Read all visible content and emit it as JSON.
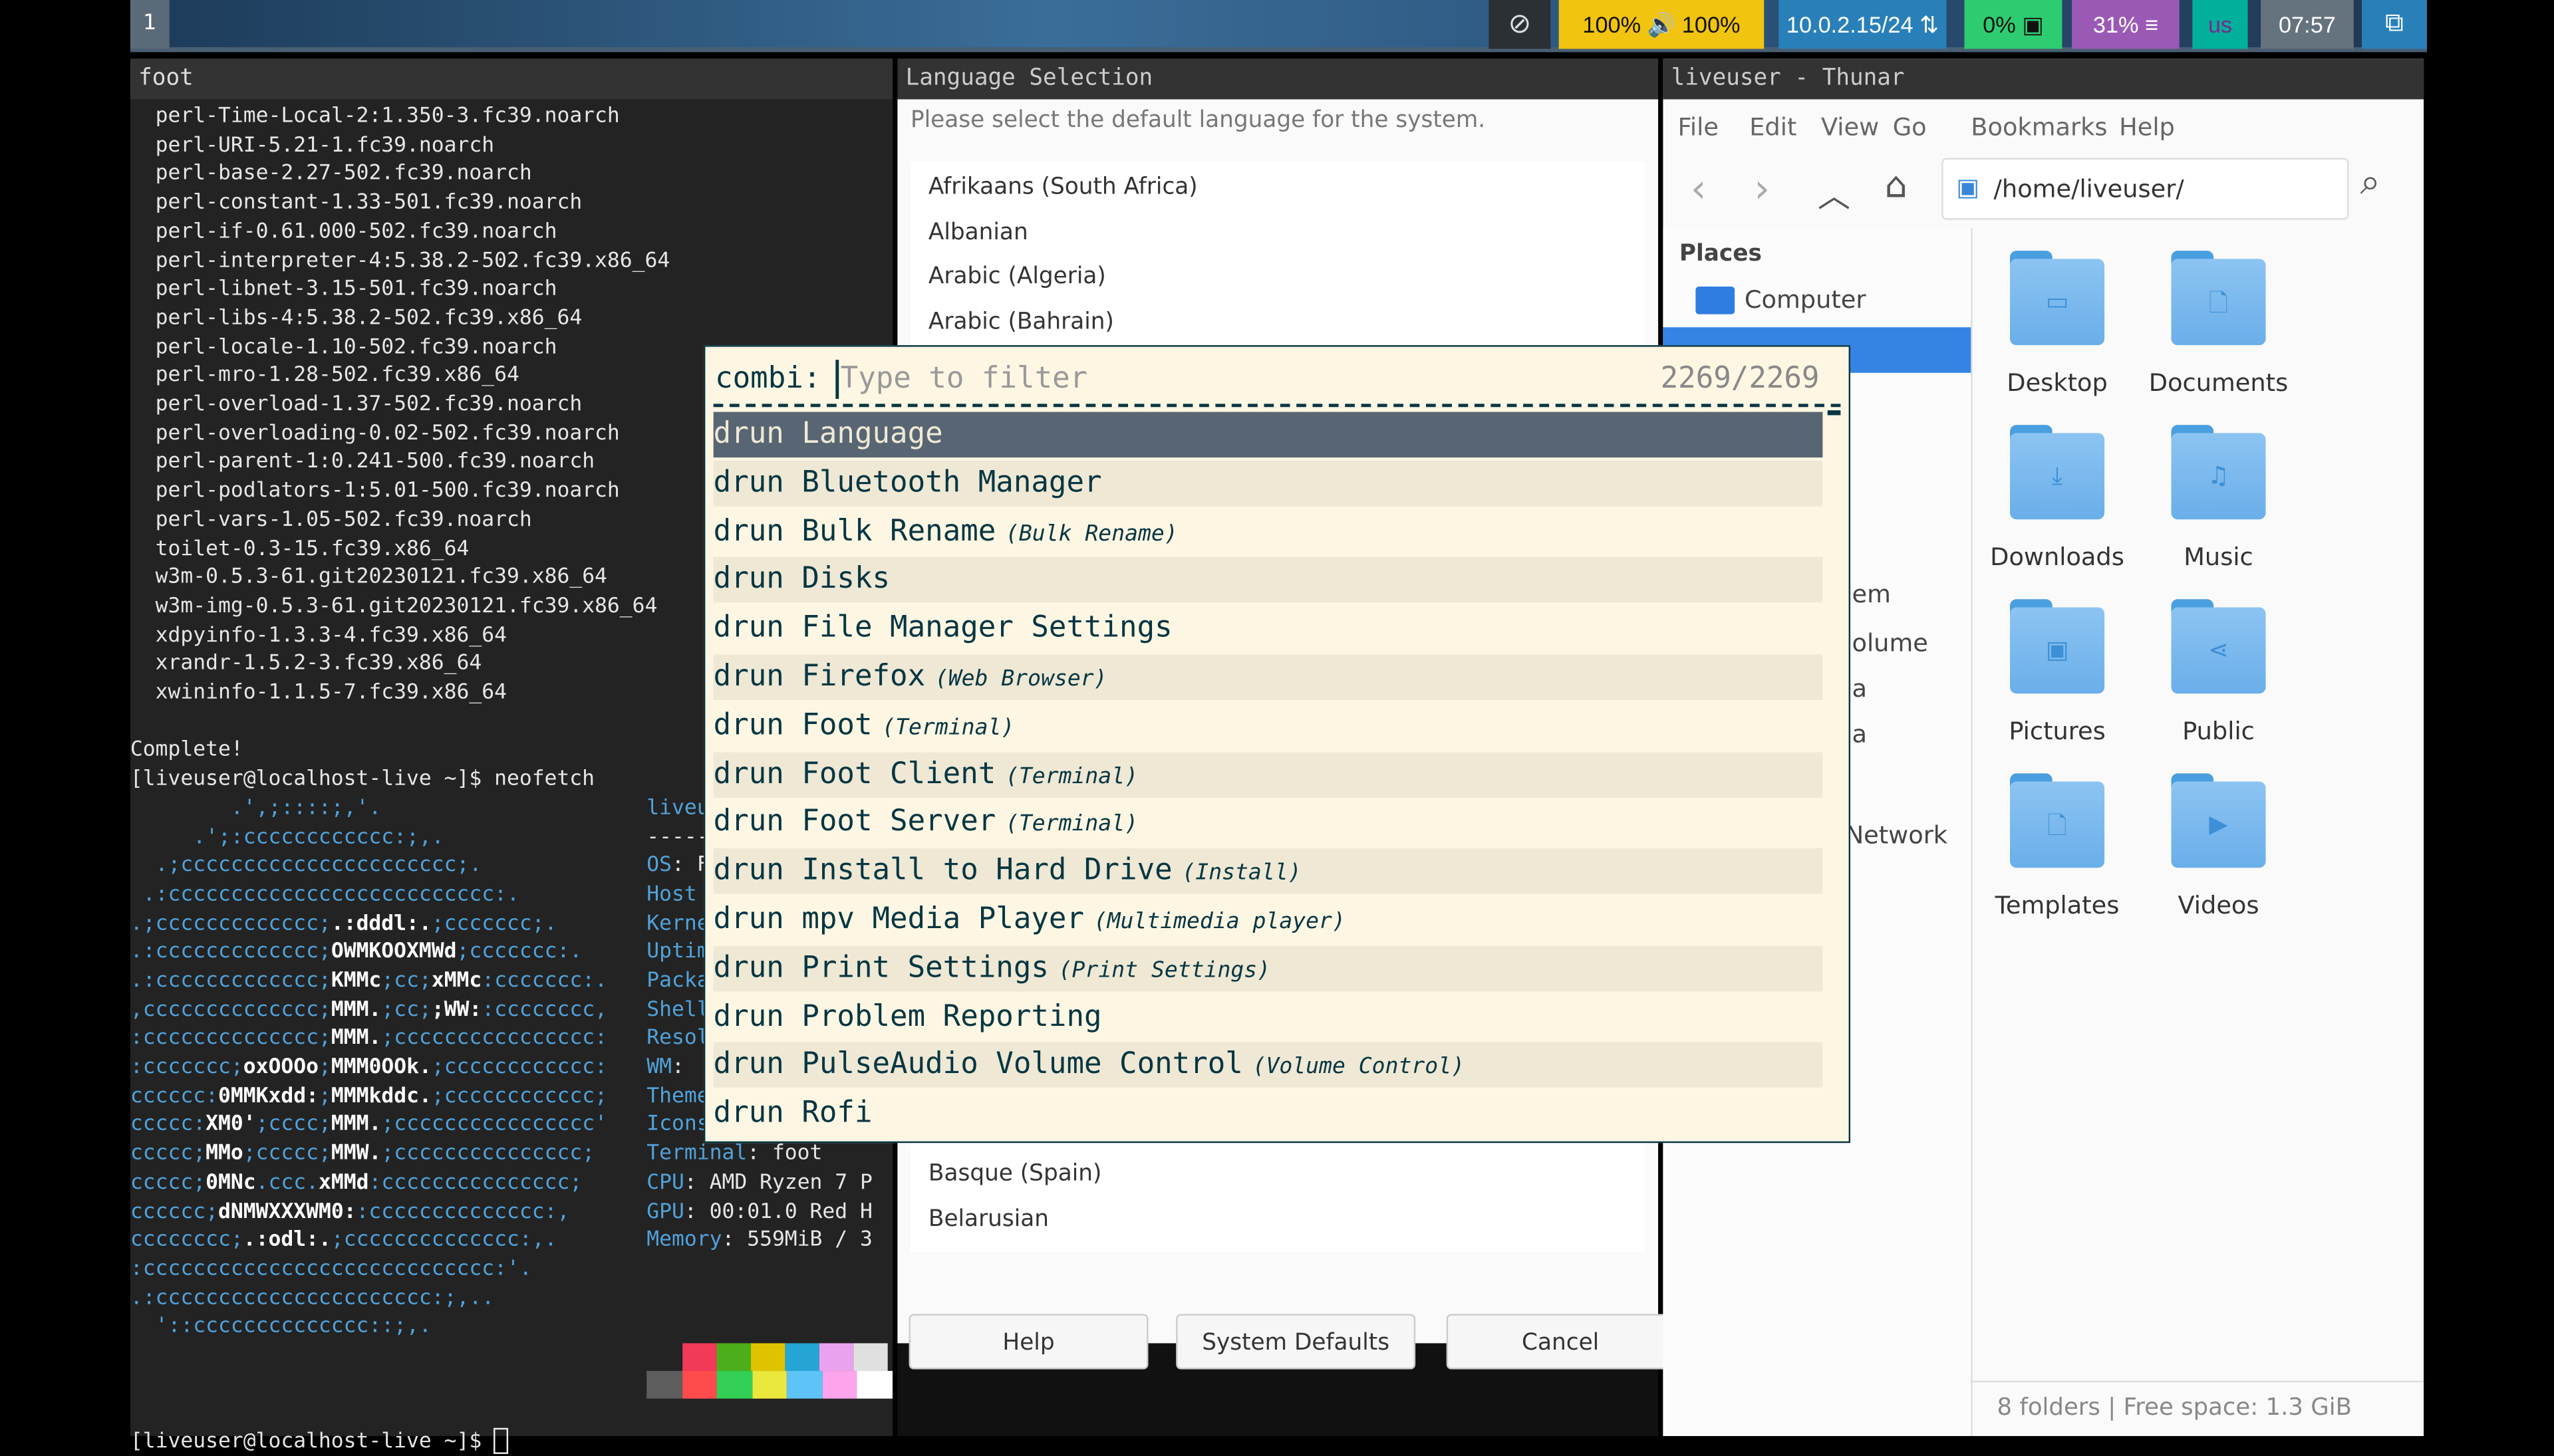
{
  "topbar": {
    "workspace": "1",
    "audio": "100% 🔊 100%",
    "network": "10.0.2.15/24",
    "cpu": "0%",
    "memory": "31%",
    "layout": "us",
    "clock": "07:57",
    "icons": [
      "eye-off-icon",
      "speaker-icon",
      "network-icon",
      "cpu-chip-icon",
      "memory-icon",
      "computers-icon"
    ],
    "colors": {
      "audio": "#f1c40f",
      "network": "#2980b9",
      "cpu": "#2ecc71",
      "memory": "#9b59b6",
      "layout": "#00b09b",
      "clock": "#65737e"
    }
  },
  "terminal": {
    "title": "foot",
    "packages": [
      "perl-Time-Local-2:1.350-3.fc39.noarch",
      "perl-URI-5.21-1.fc39.noarch",
      "perl-base-2.27-502.fc39.noarch",
      "perl-constant-1.33-501.fc39.noarch",
      "perl-if-0.61.000-502.fc39.noarch",
      "perl-interpreter-4:5.38.2-502.fc39.x86_64",
      "perl-libnet-3.15-501.fc39.noarch",
      "perl-libs-4:5.38.2-502.fc39.x86_64",
      "perl-locale-1.10-502.fc39.noarch",
      "perl-mro-1.28-502.fc39.x86_64",
      "perl-overload-1.37-502.fc39.noarch",
      "perl-overloading-0.02-502.fc39.noarch",
      "perl-parent-1:0.241-500.fc39.noarch",
      "perl-podlators-1:5.01-500.fc39.noarch",
      "perl-vars-1.05-502.fc39.noarch",
      "toilet-0.3-15.fc39.x86_64",
      "w3m-0.5.3-61.git20230121.fc39.x86_64",
      "w3m-img-0.5.3-61.git20230121.fc39.x86_64",
      "xdpyinfo-1.3.3-4.fc39.x86_64",
      "xrandr-1.5.2-3.fc39.x86_64",
      "xwininfo-1.1.5-7.fc39.x86_64"
    ],
    "complete": "Complete!",
    "prompt_cmd": "[liveuser@localhost-live ~]$ neofetch",
    "prompt_end": "[liveuser@localhost-live ~]$ ",
    "logo": [
      [
        [
          "        .',;::::;,'.",
          "b"
        ]
      ],
      [
        [
          "     .';:cccccccccccc:;,.",
          "b"
        ]
      ],
      [
        [
          "  .;cccccccccccccccccccccc;.",
          "b"
        ]
      ],
      [
        [
          " .:cccccccccccccccccccccccccc:.",
          "b"
        ]
      ],
      [
        [
          ".;ccccccccccccc;",
          "b"
        ],
        [
          ".:dddl:.",
          "w"
        ],
        [
          ";ccccccc;.",
          "b"
        ]
      ],
      [
        [
          ".:ccccccccccccc;",
          "b"
        ],
        [
          "OWMKOOXMWd",
          "w"
        ],
        [
          ";ccccccc:.",
          "b"
        ]
      ],
      [
        [
          ".:ccccccccccccc;",
          "b"
        ],
        [
          "KMMc",
          "w"
        ],
        [
          ";cc;",
          "b"
        ],
        [
          "xMMc",
          "w"
        ],
        [
          ":ccccccc:.",
          "b"
        ]
      ],
      [
        [
          ",cccccccccccccc;",
          "b"
        ],
        [
          "MMM.",
          "w"
        ],
        [
          ";cc;",
          "b"
        ],
        [
          ";WW:",
          "w"
        ],
        [
          ":cccccccc,",
          "b"
        ]
      ],
      [
        [
          ":cccccccccccccc;",
          "b"
        ],
        [
          "MMM.",
          "w"
        ],
        [
          ";cccccccccccccccc:",
          "b"
        ]
      ],
      [
        [
          ":ccccccc;",
          "b"
        ],
        [
          "oxOOOo",
          "w"
        ],
        [
          ";",
          "b"
        ],
        [
          "MMM0OOk.",
          "w"
        ],
        [
          ";cccccccccccc:",
          "b"
        ]
      ],
      [
        [
          "cccccc:",
          "b"
        ],
        [
          "0MMKxdd:",
          "w"
        ],
        [
          ";",
          "b"
        ],
        [
          "MMMkddc.",
          "w"
        ],
        [
          ";cccccccccccc;",
          "b"
        ]
      ],
      [
        [
          "ccccc:",
          "b"
        ],
        [
          "XM0'",
          "w"
        ],
        [
          ";cccc;",
          "b"
        ],
        [
          "MMM.",
          "w"
        ],
        [
          ";cccccccccccccccc'",
          "b"
        ]
      ],
      [
        [
          "ccccc;",
          "b"
        ],
        [
          "MMo",
          "w"
        ],
        [
          ";ccccc;",
          "b"
        ],
        [
          "MMW.",
          "w"
        ],
        [
          ";ccccccccccccccc;",
          "b"
        ]
      ],
      [
        [
          "ccccc;",
          "b"
        ],
        [
          "0MNc",
          "w"
        ],
        [
          ".ccc.",
          "b"
        ],
        [
          "xMMd",
          "w"
        ],
        [
          ":ccccccccccccccc;",
          "b"
        ]
      ],
      [
        [
          "cccccc;",
          "b"
        ],
        [
          "dNMWXXXWM0:",
          "w"
        ],
        [
          ":cccccccccccccc:,",
          "b"
        ]
      ],
      [
        [
          "cccccccc;",
          "b"
        ],
        [
          ".:odl:.",
          "w"
        ],
        [
          ";cccccccccccccc:,.",
          "b"
        ]
      ],
      [
        [
          ":cccccccccccccccccccccccccccc:'.",
          "b"
        ]
      ],
      [
        [
          ".:cccccccccccccccccccccc:;,..",
          "b"
        ]
      ],
      [
        [
          "  '::cccccccccccccc::;,.",
          "b"
        ]
      ]
    ],
    "info": [
      [
        [
          "liveu",
          "b"
        ]
      ],
      [
        [
          "-----",
          ""
        ]
      ],
      [
        [
          "OS",
          "b"
        ],
        [
          ": F",
          ""
        ]
      ],
      [
        [
          "Host",
          "b"
        ]
      ],
      [
        [
          "Kerne",
          "b"
        ]
      ],
      [
        [
          "Uptim",
          "b"
        ]
      ],
      [
        [
          "Packa",
          "b"
        ]
      ],
      [
        [
          "Shell",
          "b"
        ]
      ],
      [
        [
          "Resol",
          "b"
        ]
      ],
      [
        [
          "WM",
          "b"
        ],
        [
          ": ",
          ""
        ]
      ],
      [
        [
          "Theme",
          "b"
        ]
      ],
      [
        [
          "Icons",
          "b"
        ]
      ],
      [
        [
          "Terminal",
          "b"
        ],
        [
          ": foot",
          ""
        ]
      ],
      [
        [
          "CPU",
          "b"
        ],
        [
          ": AMD Ryzen 7 P",
          ""
        ]
      ],
      [
        [
          "GPU",
          "b"
        ],
        [
          ": 00:01.0 Red H",
          ""
        ]
      ],
      [
        [
          "Memory",
          "b"
        ],
        [
          ": 559MiB / 3",
          ""
        ]
      ]
    ],
    "palette_top": [
      "#f03a57",
      "#4cae1a",
      "#e0c300",
      "#25a5d4",
      "#e9a2ee",
      "#e0e0e0"
    ],
    "palette_bottom": [
      "#5e5e5e",
      "#ff4b4b",
      "#33d055",
      "#eae83d",
      "#5ec4f7",
      "#fca4ec",
      "#ffffff"
    ]
  },
  "language": {
    "title": "Language Selection",
    "prompt": "Please select the default language for the system.",
    "items_top": [
      "Afrikaans (South Africa)",
      "Albanian",
      "Arabic (Algeria)",
      "Arabic (Bahrain)"
    ],
    "items_bottom": [
      "Basque (Spain)",
      "Belarusian"
    ],
    "help": "Help",
    "defaults": "System Defaults",
    "cancel": "Cancel"
  },
  "thunar": {
    "title": "liveuser - Thunar",
    "menu": [
      "File",
      "Edit",
      "View",
      "Go",
      "Bookmarks",
      "Help"
    ],
    "path": "/home/liveuser/",
    "places": "Places",
    "computer": "Computer",
    "sidebar_fragments": [
      "em",
      "olume",
      "a",
      "a",
      "Network"
    ],
    "folders": [
      "Desktop",
      "Documents",
      "Downloads",
      "Music",
      "Pictures",
      "Public",
      "Templates",
      "Videos"
    ],
    "folder_glyphs": [
      "▭",
      "🗋",
      "⤓",
      "♫",
      "▣",
      "⋖",
      "🗋",
      "▶"
    ],
    "status": "8 folders  |  Free space: 1.3 GiB"
  },
  "rofi": {
    "prompt": "combi:",
    "placeholder": "Type to filter",
    "count": "2269/2269",
    "entries": [
      {
        "name": "drun Language",
        "comment": ""
      },
      {
        "name": "drun Bluetooth Manager",
        "comment": ""
      },
      {
        "name": "drun Bulk Rename",
        "comment": "(Bulk Rename)"
      },
      {
        "name": "drun Disks",
        "comment": ""
      },
      {
        "name": "drun File Manager Settings",
        "comment": ""
      },
      {
        "name": "drun Firefox",
        "comment": "(Web Browser)"
      },
      {
        "name": "drun Foot",
        "comment": "(Terminal)"
      },
      {
        "name": "drun Foot Client",
        "comment": "(Terminal)"
      },
      {
        "name": "drun Foot Server",
        "comment": "(Terminal)"
      },
      {
        "name": "drun Install to Hard Drive",
        "comment": "(Install)"
      },
      {
        "name": "drun mpv Media Player",
        "comment": "(Multimedia player)"
      },
      {
        "name": "drun Print Settings",
        "comment": "(Print Settings)"
      },
      {
        "name": "drun Problem Reporting",
        "comment": ""
      },
      {
        "name": "drun PulseAudio Volume Control",
        "comment": "(Volume Control)"
      },
      {
        "name": "drun Rofi",
        "comment": ""
      }
    ]
  }
}
